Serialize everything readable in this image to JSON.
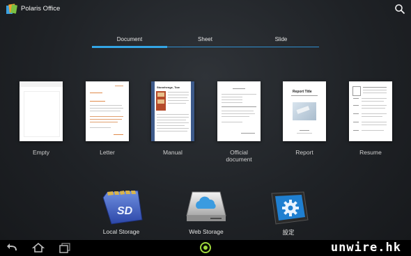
{
  "app": {
    "title": "Polaris Office"
  },
  "tabs": [
    {
      "label": "Document",
      "selected": true
    },
    {
      "label": "Sheet",
      "selected": false
    },
    {
      "label": "Slide",
      "selected": false
    }
  ],
  "templates": [
    {
      "label": "Empty"
    },
    {
      "label": "Letter"
    },
    {
      "label": "Manual"
    },
    {
      "label": "Official\ndocument"
    },
    {
      "label": "Report"
    },
    {
      "label": "Resume"
    }
  ],
  "thumb_text": {
    "manual_heading": "Stonehenge, Tow",
    "report_heading": "Report Title"
  },
  "storage": [
    {
      "label": "Local Storage"
    },
    {
      "label": "Web Storage"
    },
    {
      "label": "設定"
    }
  ],
  "navbar": {
    "watermark": "unwire.hk"
  },
  "colors": {
    "accent": "#33a5e5",
    "nav_home_ring": "#9ed63c"
  }
}
